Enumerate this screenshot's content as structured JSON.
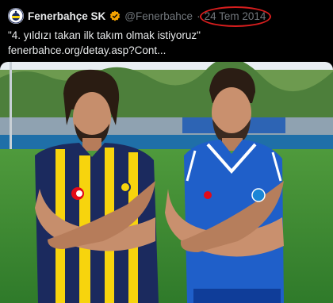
{
  "tweet": {
    "display_name": "Fenerbahçe SK",
    "handle": "@Fenerbahce",
    "separator": "·",
    "date": "24 Tem 2014",
    "text_quote": "\"4. yıldızı takan ilk takım olmak istiyoruz\"",
    "text_link": "fenerbahce.org/detay.asp?Cont..."
  },
  "colors": {
    "verified": "#f5a300",
    "date_highlight": "#d81e1e",
    "fb_navy": "#1b2a5e",
    "fb_yellow": "#f7d40d",
    "away_blue": "#1f5fc9"
  }
}
